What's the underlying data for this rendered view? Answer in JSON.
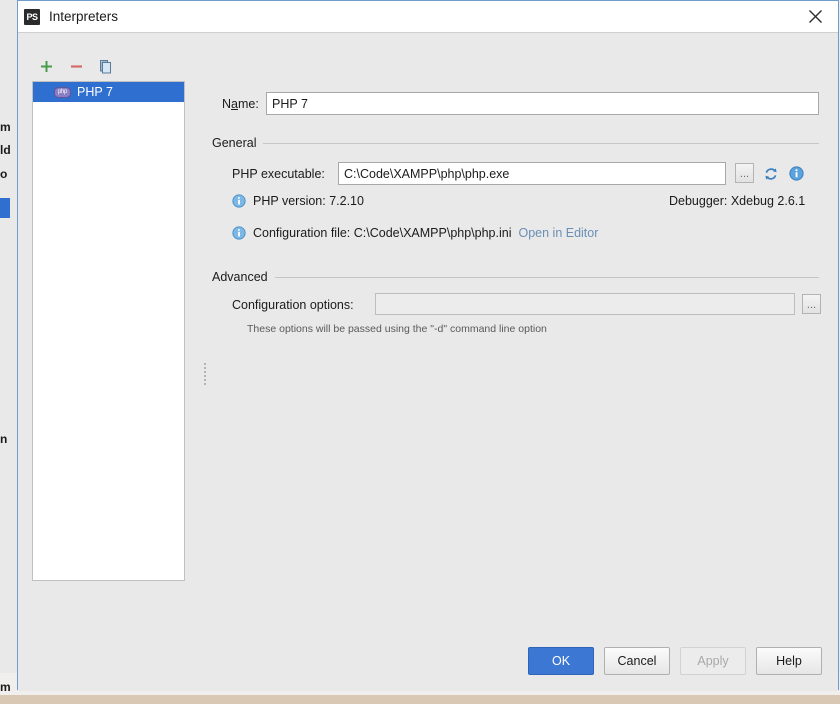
{
  "window": {
    "title": "Interpreters",
    "app_icon": "PS",
    "close_label": "×"
  },
  "background": {
    "left_fragments": [
      "m",
      "ld",
      "o",
      "n"
    ],
    "bottom_fragment": "m",
    "plus_icon": "+"
  },
  "list_panel": {
    "toolbar": {
      "add_label": "+",
      "remove_label": "−",
      "copy_label": "copy"
    },
    "items": [
      {
        "label": "PHP 7",
        "icon": "php-icon",
        "selected": true
      }
    ]
  },
  "form": {
    "name_label_pre": "N",
    "name_label_mn": "a",
    "name_label_post": "me:",
    "name_value": "PHP 7",
    "name_placeholder": "",
    "general_section": "General",
    "php_executable_label": "PHP executable:",
    "php_executable_value": "C:\\Code\\XAMPP\\php\\php.exe",
    "php_executable_placeholder": "",
    "browse_label": "...",
    "refresh_icon": "refresh-icon",
    "info_icon": "info-icon",
    "php_version_line": "PHP version: 7.2.10",
    "debugger_line": "Debugger: Xdebug 2.6.1",
    "config_file_line": "Configuration file: C:\\Code\\XAMPP\\php\\php.ini",
    "open_in_editor_link": "Open in Editor",
    "advanced_section": "Advanced",
    "config_options_label": "Configuration options:",
    "config_options_value": "",
    "config_options_placeholder": "",
    "config_options_browse_label": "...",
    "config_options_hint": "These options will be passed using the \"-d\" command line option"
  },
  "buttons": {
    "ok": "OK",
    "cancel": "Cancel",
    "apply": "Apply",
    "help": "Help"
  },
  "colors": {
    "accent": "#3c77d3",
    "selection": "#2f6fd0",
    "add": "#4a9c4a",
    "remove": "#d46a6a",
    "link": "#6a8fb5",
    "dialog_border": "#6f9ccc"
  }
}
